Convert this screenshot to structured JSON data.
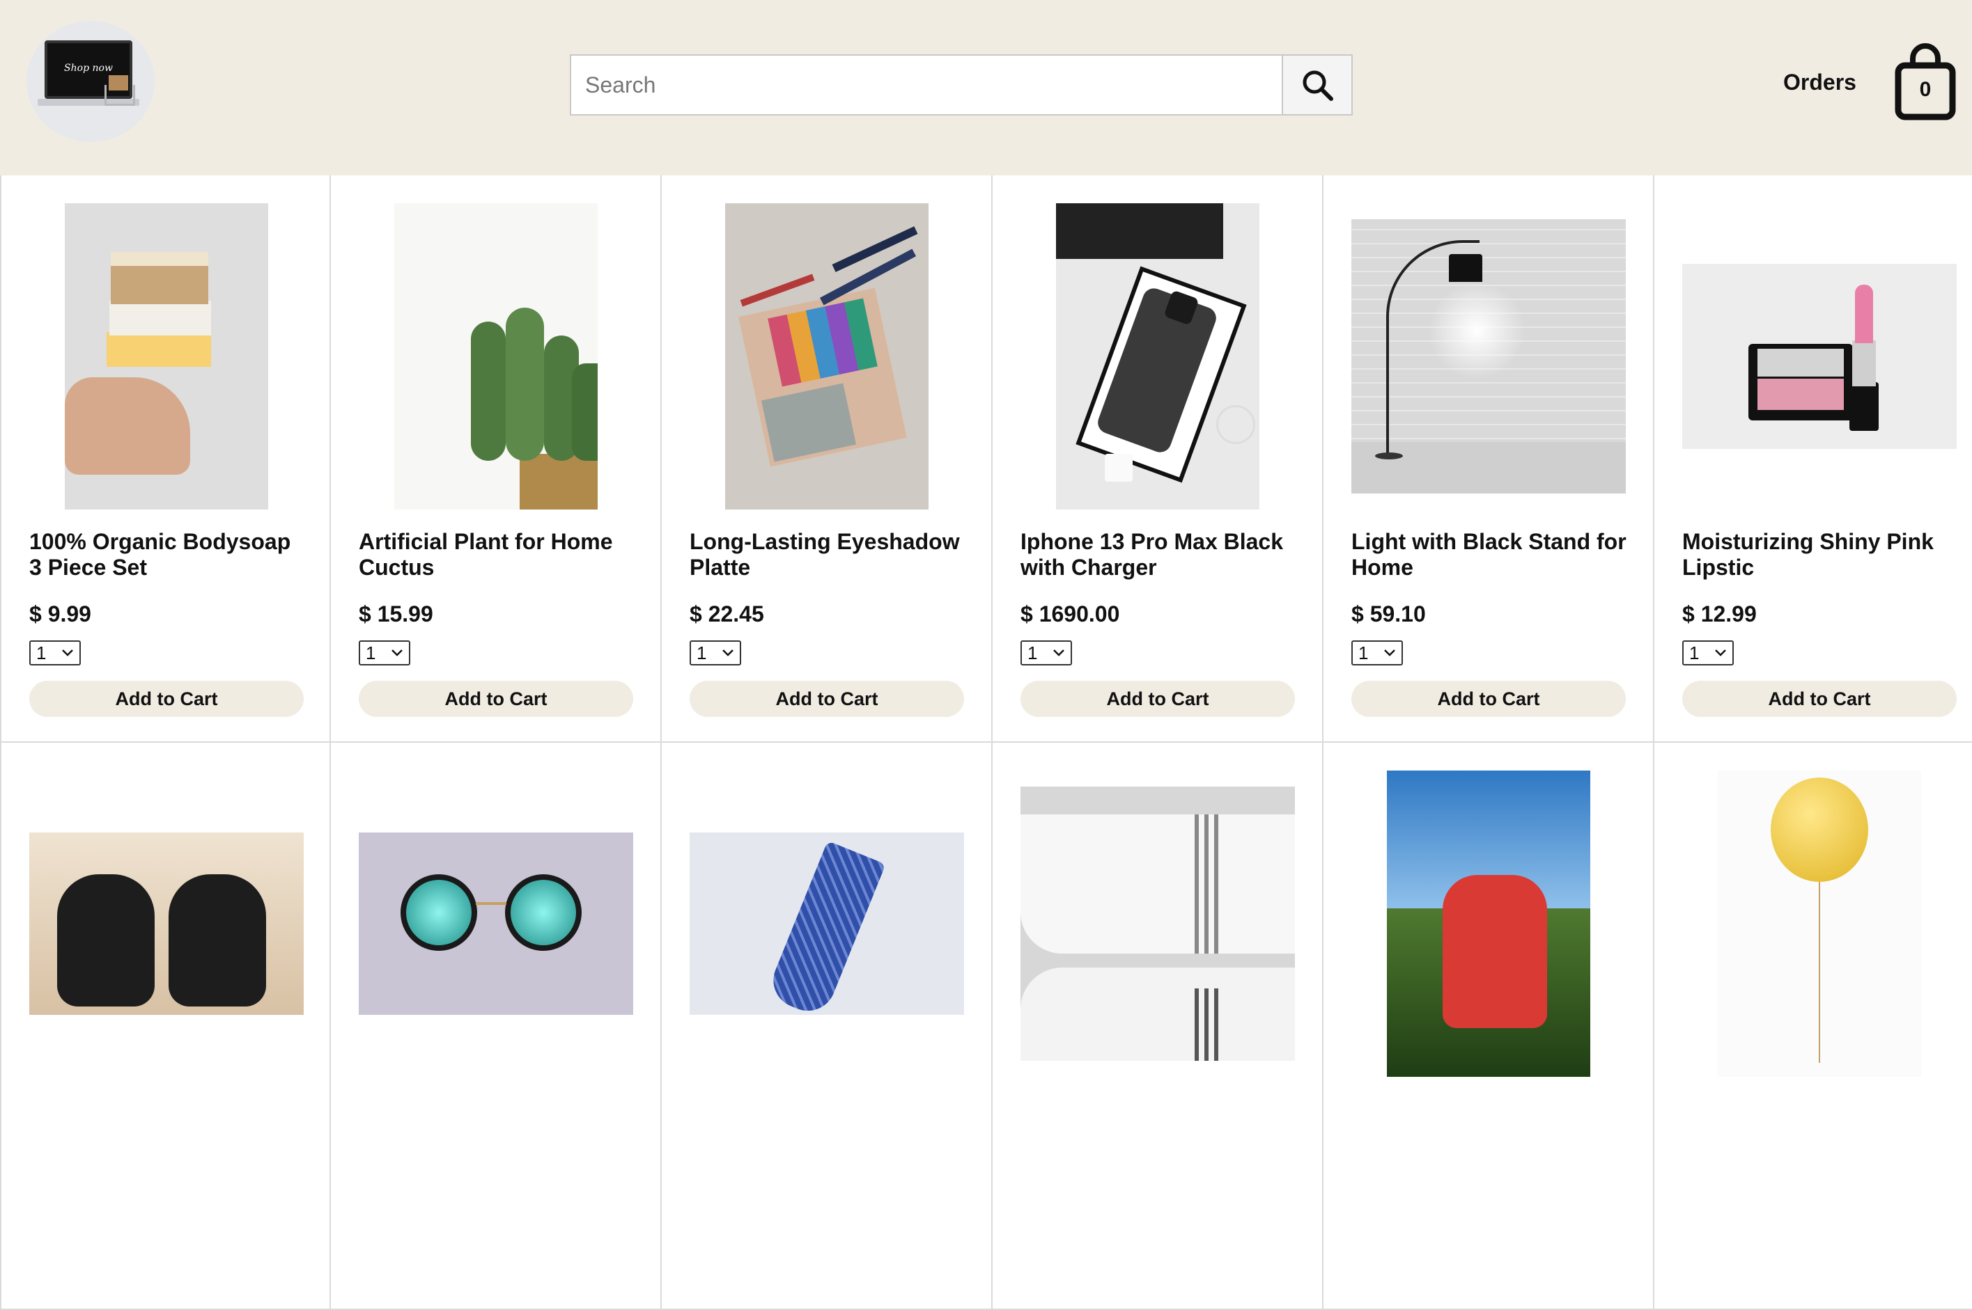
{
  "header": {
    "logo_text": "Shop now",
    "search_placeholder": "Search",
    "orders_label": "Orders",
    "cart_count": "0"
  },
  "products": [
    {
      "name": "100% Organic Bodysoap 3 Piece Set",
      "price": "$ 9.99",
      "qty": "1",
      "button": "Add to Cart",
      "image": "soap-bars-in-hand"
    },
    {
      "name": "Artificial Plant for Home Cuctus",
      "price": "$ 15.99",
      "qty": "1",
      "button": "Add to Cart",
      "image": "cactus-plant"
    },
    {
      "name": "Long-Lasting Eyeshadow Platte",
      "price": "$ 22.45",
      "qty": "1",
      "button": "Add to Cart",
      "image": "eyeshadow-palette"
    },
    {
      "name": "Iphone 13 Pro Max Black with Charger",
      "price": "$ 1690.00",
      "qty": "1",
      "button": "Add to Cart",
      "image": "iphone-box"
    },
    {
      "name": "Light with Black Stand for Home",
      "price": "$ 59.10",
      "qty": "1",
      "button": "Add to Cart",
      "image": "floor-lamp"
    },
    {
      "name": "Moisturizing Shiny Pink Lipstic",
      "price": "$ 12.99",
      "qty": "1",
      "button": "Add to Cart",
      "image": "lipstick-compact"
    },
    {
      "image": "leather-shoes"
    },
    {
      "image": "round-sunglasses"
    },
    {
      "image": "blue-tie"
    },
    {
      "image": "white-towels"
    },
    {
      "image": "red-backpack"
    },
    {
      "image": "emoji-balloon"
    }
  ]
}
